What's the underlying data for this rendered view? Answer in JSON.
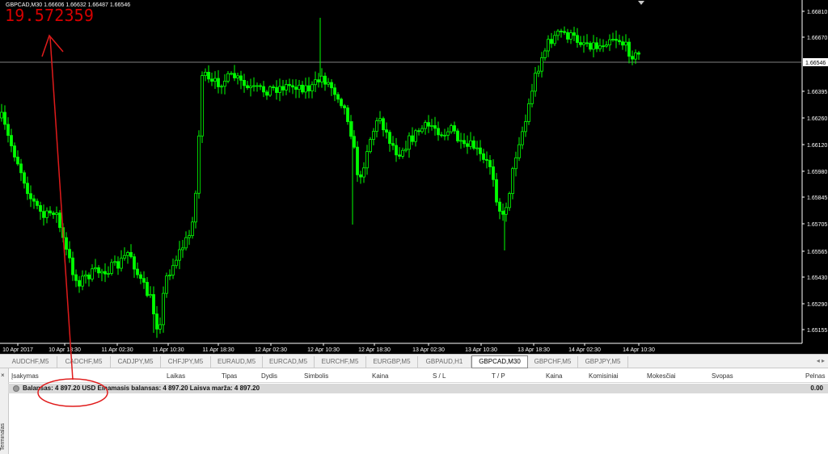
{
  "chart": {
    "header": "GBPCAD,M30  1.66606 1.66632 1.66487 1.66546",
    "big_value": "19.572359",
    "current_price_label": "1.66546",
    "price_levels": [
      "1.66810",
      "1.66670",
      "1.66546",
      "1.66395",
      "1.66260",
      "1.66120",
      "1.65980",
      "1.65845",
      "1.65705",
      "1.65565",
      "1.65430",
      "1.65290",
      "1.65155"
    ],
    "time_labels": [
      "10 Apr 2017",
      "10 Apr 18:30",
      "11 Apr 02:30",
      "11 Apr 10:30",
      "11 Apr 18:30",
      "12 Apr 02:30",
      "12 Apr 10:30",
      "12 Apr 18:30",
      "13 Apr 02:30",
      "13 Apr 10:30",
      "13 Apr 18:30",
      "14 Apr 02:30",
      "14 Apr 10:30"
    ],
    "colors": {
      "background": "#000000",
      "candle": "#00ff00",
      "annotation": "#e01b1b",
      "grid_line": "#808080"
    }
  },
  "tabs": [
    {
      "label": "AUDCHF,M5",
      "active": false
    },
    {
      "label": "CADCHF,M5",
      "active": false
    },
    {
      "label": "CADJPY,M5",
      "active": false
    },
    {
      "label": "CHFJPY,M5",
      "active": false
    },
    {
      "label": "EURAUD,M5",
      "active": false
    },
    {
      "label": "EURCAD,M5",
      "active": false
    },
    {
      "label": "EURCHF,M5",
      "active": false
    },
    {
      "label": "EURGBP,M5",
      "active": false
    },
    {
      "label": "GBPAUD,H1",
      "active": false
    },
    {
      "label": "GBPCAD,M30",
      "active": true
    },
    {
      "label": "GBPCHF,M5",
      "active": false
    },
    {
      "label": "GBPJPY,M5",
      "active": false
    }
  ],
  "terminal": {
    "close_icon": "×",
    "side_label": "Terminalas",
    "columns": [
      "Įsakymas",
      "Laikas",
      "Tipas",
      "Dydis",
      "Simbolis",
      "Kaina",
      "S / L",
      "T / P",
      "Kaina",
      "Komisiniai",
      "Mokesčiai",
      "Svopas",
      "Pelnas"
    ],
    "balance_line": "Balansas: 4 897.20 USD   Einamasis balansas: 4 897.20   Laisva marža: 4 897.20",
    "profit_total": "0.00"
  }
}
